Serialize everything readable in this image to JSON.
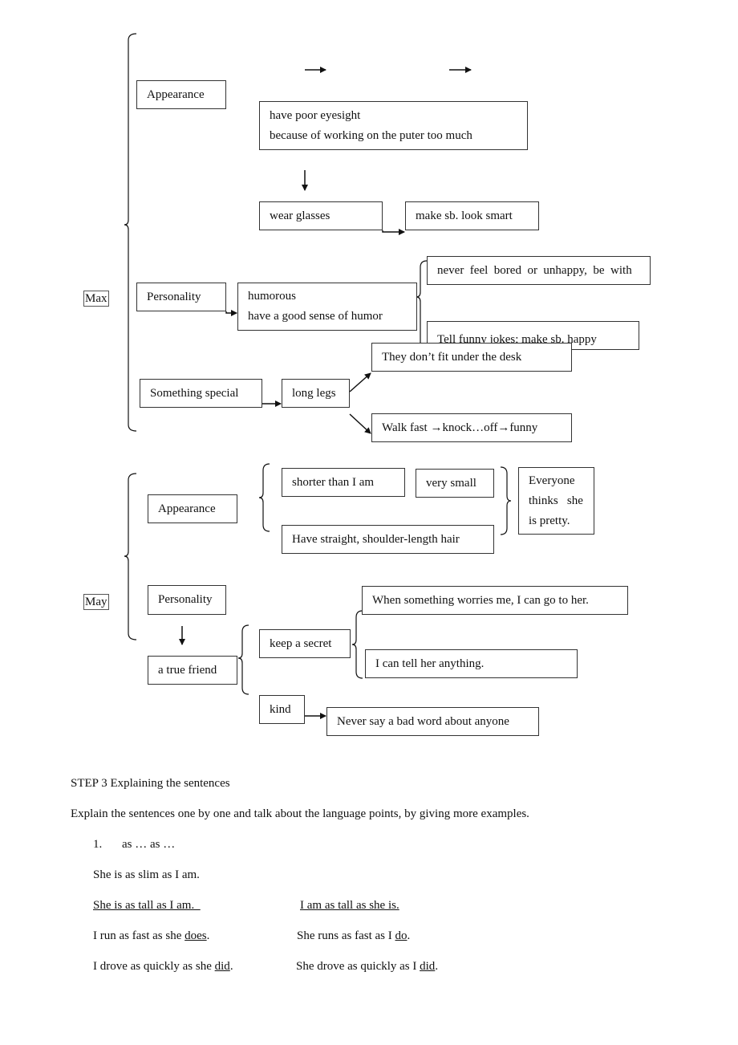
{
  "max": {
    "label": "Max",
    "appearance": "Appearance",
    "eyesight": [
      "have poor eyesight",
      "because of working on the puter too much"
    ],
    "wear_glasses": "wear glasses",
    "look_smart": "make sb. look smart",
    "personality": "Personality",
    "humorous": [
      "humorous",
      "have a good sense of humor"
    ],
    "never_bored": "never  feel  bored  or  unhappy,  be  with",
    "funny_jokes": "Tell funny jokes; make sb. happy",
    "special": "Something special",
    "long_legs": "long legs",
    "desk": "They don’t fit under the desk",
    "walk_fast": "Walk fast →knock…off→funny"
  },
  "may": {
    "label": "May",
    "appearance": "Appearance",
    "shorter": "shorter than I am",
    "very_small": "very small",
    "hair": "Have straight, shoulder-length hair",
    "pretty": [
      "Everyone",
      "thinks   she",
      "is pretty."
    ],
    "personality": "Personality",
    "true_friend": "a true friend",
    "keep_secret": "keep a secret",
    "worries": "When something worries me, I can go to her.",
    "tell_anything": "I can tell her anything.",
    "kind": "kind",
    "never_say": "Never say a bad word about anyone"
  },
  "text": {
    "step": "STEP 3 Explaining the sentences",
    "explain": "Explain the sentences one by one and talk about the language points, by giving more examples.",
    "item_num": "1.",
    "item_title": "as … as …",
    "ex1": "She is as slim as I am.",
    "ex2a": "She is as tall as I am.  ",
    "ex2b": "I am as tall as she is.",
    "ex3a": [
      "I run as fast as she ",
      "does",
      "."
    ],
    "ex3b": [
      "She runs as fast as I ",
      "do",
      "."
    ],
    "ex4a": [
      "I drove as quickly as she ",
      "did",
      "."
    ],
    "ex4b": [
      "She drove as quickly as I ",
      "did",
      "."
    ]
  }
}
